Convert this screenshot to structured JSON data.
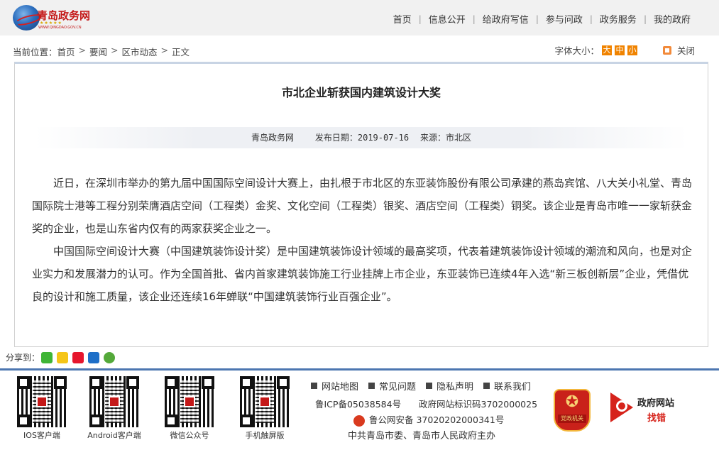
{
  "header": {
    "logo_title": "青岛政务网",
    "logo_url": "WWW.QINGDAO.GOV.CN",
    "nav": [
      "首页",
      "信息公开",
      "给政府写信",
      "参与问政",
      "政务服务",
      "我的政府"
    ]
  },
  "breadcrumb": {
    "label": "当前位置：",
    "items": [
      "首页",
      "要闻",
      "区市动态",
      "正文"
    ]
  },
  "tools": {
    "font_size_label": "字体大小：",
    "sizes": [
      "大",
      "中",
      "小"
    ],
    "close_label": "关闭"
  },
  "article": {
    "title": "市北企业斩获国内建筑设计大奖",
    "source": "青岛政务网",
    "date_label": "发布日期：",
    "date": "2019-07-16",
    "origin_label": "来源：",
    "origin": "市北区",
    "paragraphs": [
      "近日，在深圳市举办的第九届中国国际空间设计大赛上，由扎根于市北区的东亚装饰股份有限公司承建的燕岛宾馆、八大关小礼堂、青岛国际院士港等工程分别荣膺酒店空间（工程类）金奖、文化空间（工程类）银奖、酒店空间（工程类）铜奖。该企业是青岛市唯一一家斩获金奖的企业，也是山东省内仅有的两家获奖企业之一。",
      "中国国际空间设计大赛（中国建筑装饰设计奖）是中国建筑装饰设计领域的最高奖项，代表着建筑装饰设计领域的潮流和风向，也是对企业实力和发展潜力的认可。作为全国首批、省内首家建筑装饰施工行业挂牌上市企业，东亚装饰已连续4年入选“新三板创新层”企业，凭借优良的设计和施工质量，该企业还连续16年蝉联“中国建筑装饰行业百强企业”。"
    ]
  },
  "share": {
    "label": "分享到：",
    "icons": [
      "wechat-icon",
      "qzone-icon",
      "weibo-icon",
      "renren-icon",
      "kaixin-icon"
    ]
  },
  "footer": {
    "qr_labels": [
      "IOS客户端",
      "Android客户端",
      "微信公众号",
      "手机触屏版"
    ],
    "links": [
      "网站地图",
      "常见问题",
      "隐私声明",
      "联系我们"
    ],
    "icp": "鲁ICP备05038584号",
    "site_id": "政府网站标识码3702000025",
    "police": "鲁公网安备 37020202000341号",
    "sponsor": "中共青岛市委、青岛市人民政府主办",
    "party_badge_caption": "党政机关",
    "findbug_line1": "政府网站",
    "findbug_line2": "找错"
  },
  "colors": {
    "accent_orange": "#f08300",
    "footer_blue": "#4c76b0",
    "brand_red": "#c41818"
  }
}
